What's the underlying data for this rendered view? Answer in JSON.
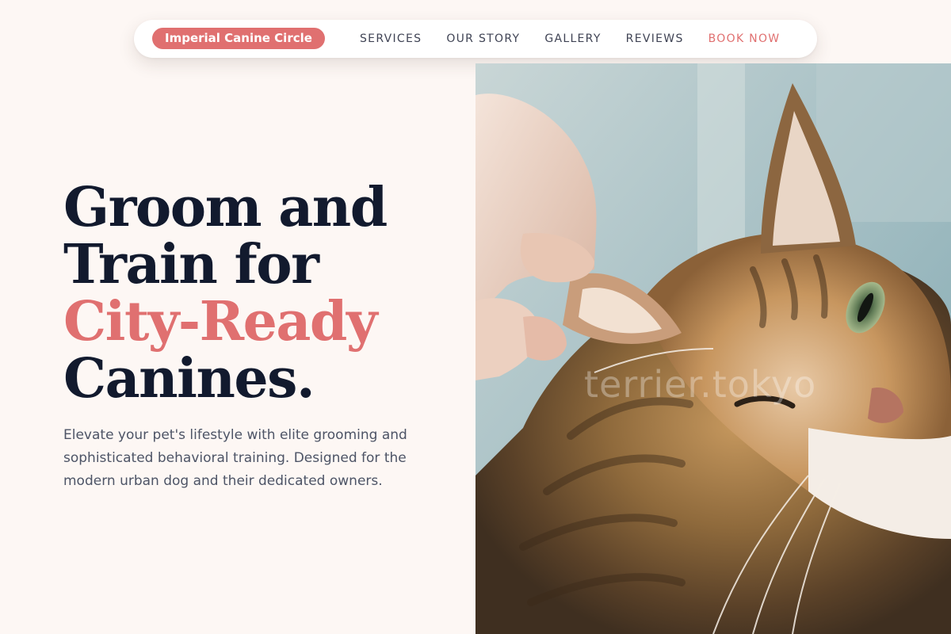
{
  "nav": {
    "brand": "Imperial Canine Circle",
    "links": [
      {
        "label": "SERVICES"
      },
      {
        "label": "OUR STORY"
      },
      {
        "label": "GALLERY"
      },
      {
        "label": "REVIEWS"
      },
      {
        "label": "BOOK NOW"
      }
    ]
  },
  "hero": {
    "headline": {
      "line1": "Groom and",
      "line2": "Train for",
      "line3": "City-Ready",
      "line4": "Canines."
    },
    "lead": "Elevate your pet's lifestyle with elite grooming and sophisticated behavioral training. Designed for the modern urban dog and their dedicated owners.",
    "image": {
      "subject": "tabby-cat-ear-being-held",
      "watermark": "terrier.tokyo"
    }
  },
  "colors": {
    "background": "#fdf7f4",
    "accent": "#e07070",
    "heading": "#121a2e",
    "body_text": "#4d5466",
    "nav_text": "#3f4354"
  }
}
